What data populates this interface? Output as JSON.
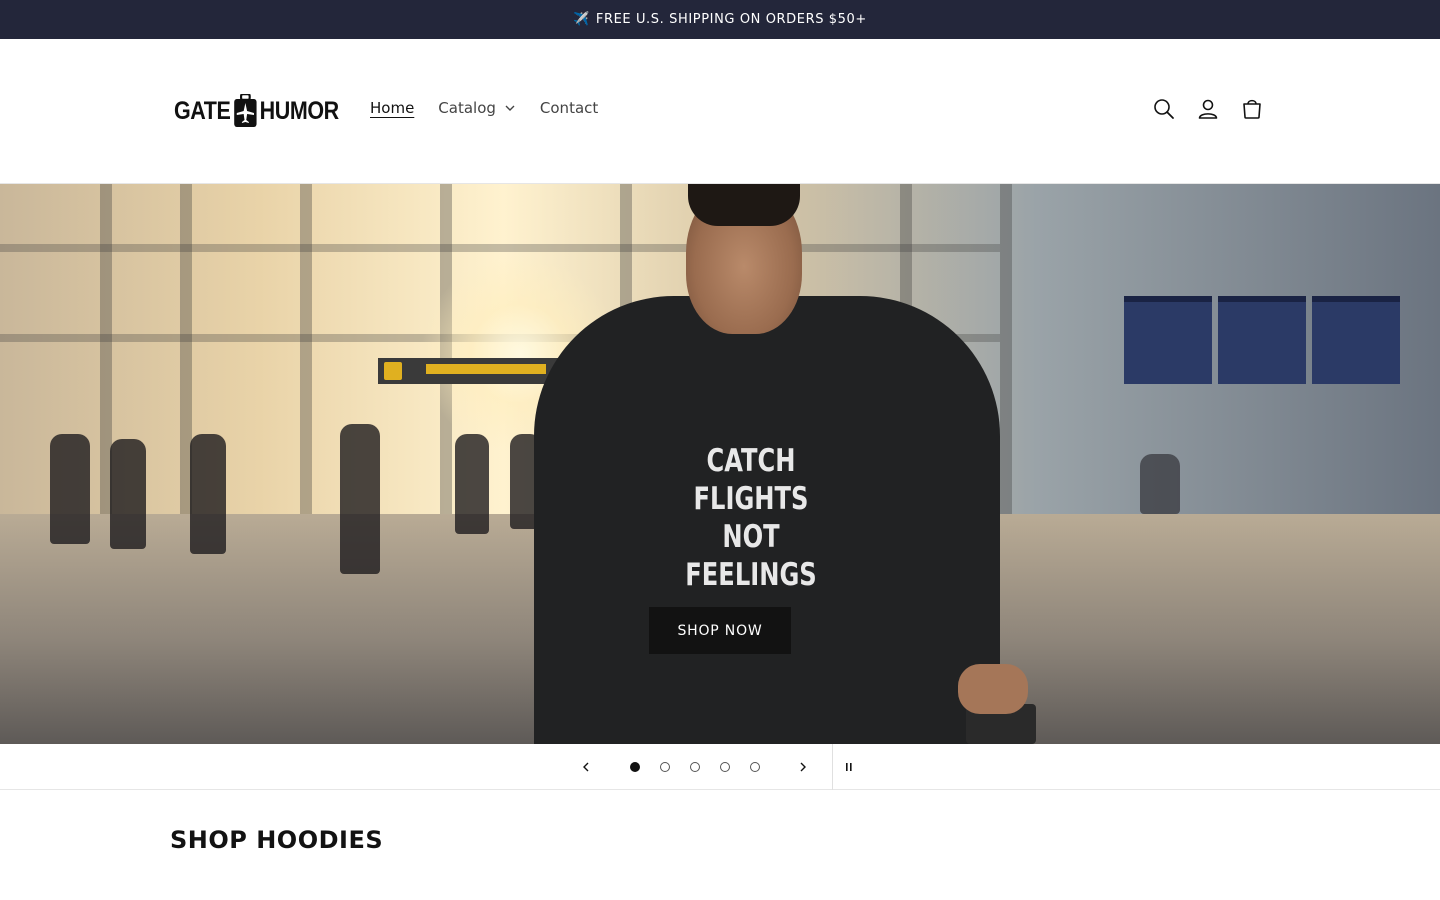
{
  "announcement": {
    "icon": "airplane-icon",
    "glyph": "✈️",
    "text": "FREE U.S. SHIPPING ON ORDERS $50+"
  },
  "header": {
    "logo": {
      "left_text": "GATE",
      "right_text": "HUMOR",
      "icon": "luggage-plane-icon"
    },
    "nav": [
      {
        "label": "Home",
        "active": true
      },
      {
        "label": "Catalog",
        "has_dropdown": true
      },
      {
        "label": "Contact"
      }
    ],
    "icons": [
      "search-icon",
      "account-icon",
      "cart-icon"
    ]
  },
  "hero": {
    "hoodie_line1": "CATCH FLIGHTS",
    "hoodie_line2": "NOT FEELINGS",
    "button_label": "SHOP NOW"
  },
  "slider": {
    "slide_count": 5,
    "active_slide": 1,
    "controls": [
      "previous-slide",
      "next-slide",
      "pause"
    ]
  },
  "section": {
    "title": "SHOP HOODIES"
  },
  "colors": {
    "announcement_bg": "#23263a",
    "button_bg": "#121212",
    "text": "#121212"
  }
}
